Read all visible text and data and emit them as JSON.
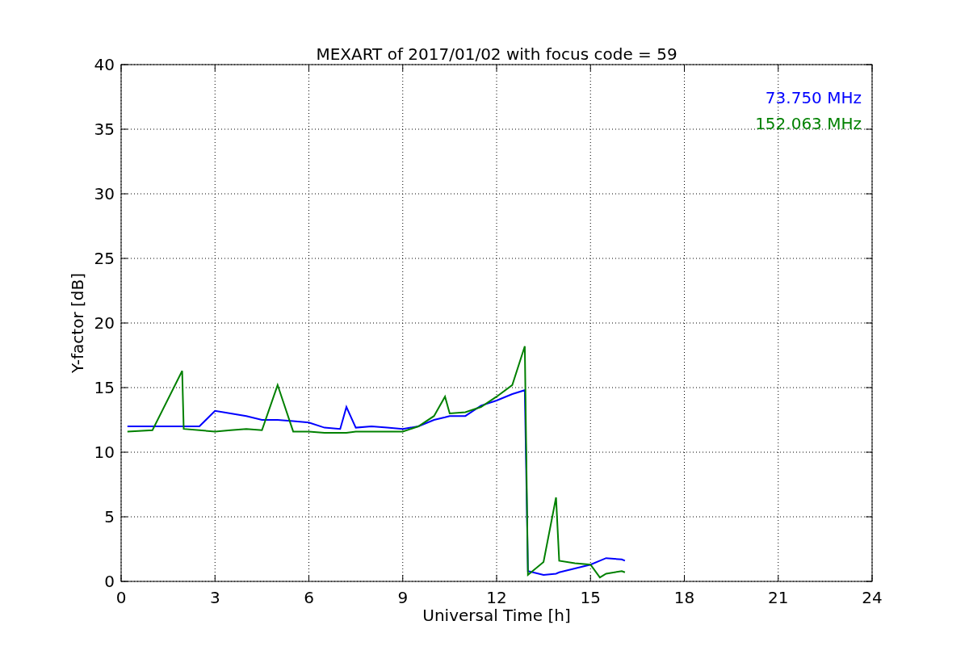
{
  "chart_data": {
    "type": "line",
    "title": "MEXART of 2017/01/02 with focus code = 59",
    "xlabel": "Universal Time [h]",
    "ylabel": "Y-factor [dB]",
    "x": [
      0.2,
      1,
      1.95,
      2,
      2.5,
      3,
      3.5,
      4,
      4.5,
      5,
      5.5,
      6,
      6.5,
      7,
      7.2,
      7.5,
      8,
      8.5,
      9,
      9.5,
      10,
      10.35,
      10.5,
      11,
      11.5,
      12,
      12.5,
      12.9,
      13,
      13.5,
      13.9,
      14,
      14.5,
      15,
      15.3,
      15.5,
      16,
      16.1
    ],
    "series": [
      {
        "name": "73.750 MHz",
        "color": "#0000ff",
        "values": [
          12,
          12,
          12,
          12,
          12,
          13.2,
          13,
          12.8,
          12.5,
          12.5,
          12.4,
          12.3,
          11.9,
          11.8,
          13.5,
          11.9,
          12,
          11.9,
          11.8,
          12,
          12.5,
          12.7,
          12.8,
          12.8,
          13.6,
          14,
          14.5,
          14.8,
          0.8,
          0.5,
          0.6,
          0.7,
          1,
          1.3,
          1.6,
          1.8,
          1.7,
          1.6
        ]
      },
      {
        "name": "152.063 MHz",
        "color": "#008000",
        "values": [
          11.6,
          11.7,
          16.3,
          11.8,
          11.7,
          11.6,
          11.7,
          11.8,
          11.7,
          15.2,
          11.6,
          11.6,
          11.5,
          11.5,
          11.5,
          11.6,
          11.6,
          11.6,
          11.6,
          12,
          12.8,
          14.3,
          13,
          13.1,
          13.5,
          14.3,
          15.2,
          18.2,
          0.5,
          1.5,
          6.5,
          1.6,
          1.4,
          1.3,
          0.3,
          0.6,
          0.8,
          0.7
        ]
      }
    ],
    "xlim": [
      0,
      24
    ],
    "ylim": [
      0,
      40
    ],
    "xticks": [
      0,
      3,
      6,
      9,
      12,
      15,
      18,
      21,
      24
    ],
    "yticks": [
      0,
      5,
      10,
      15,
      20,
      25,
      30,
      35,
      40
    ],
    "grid": true
  }
}
